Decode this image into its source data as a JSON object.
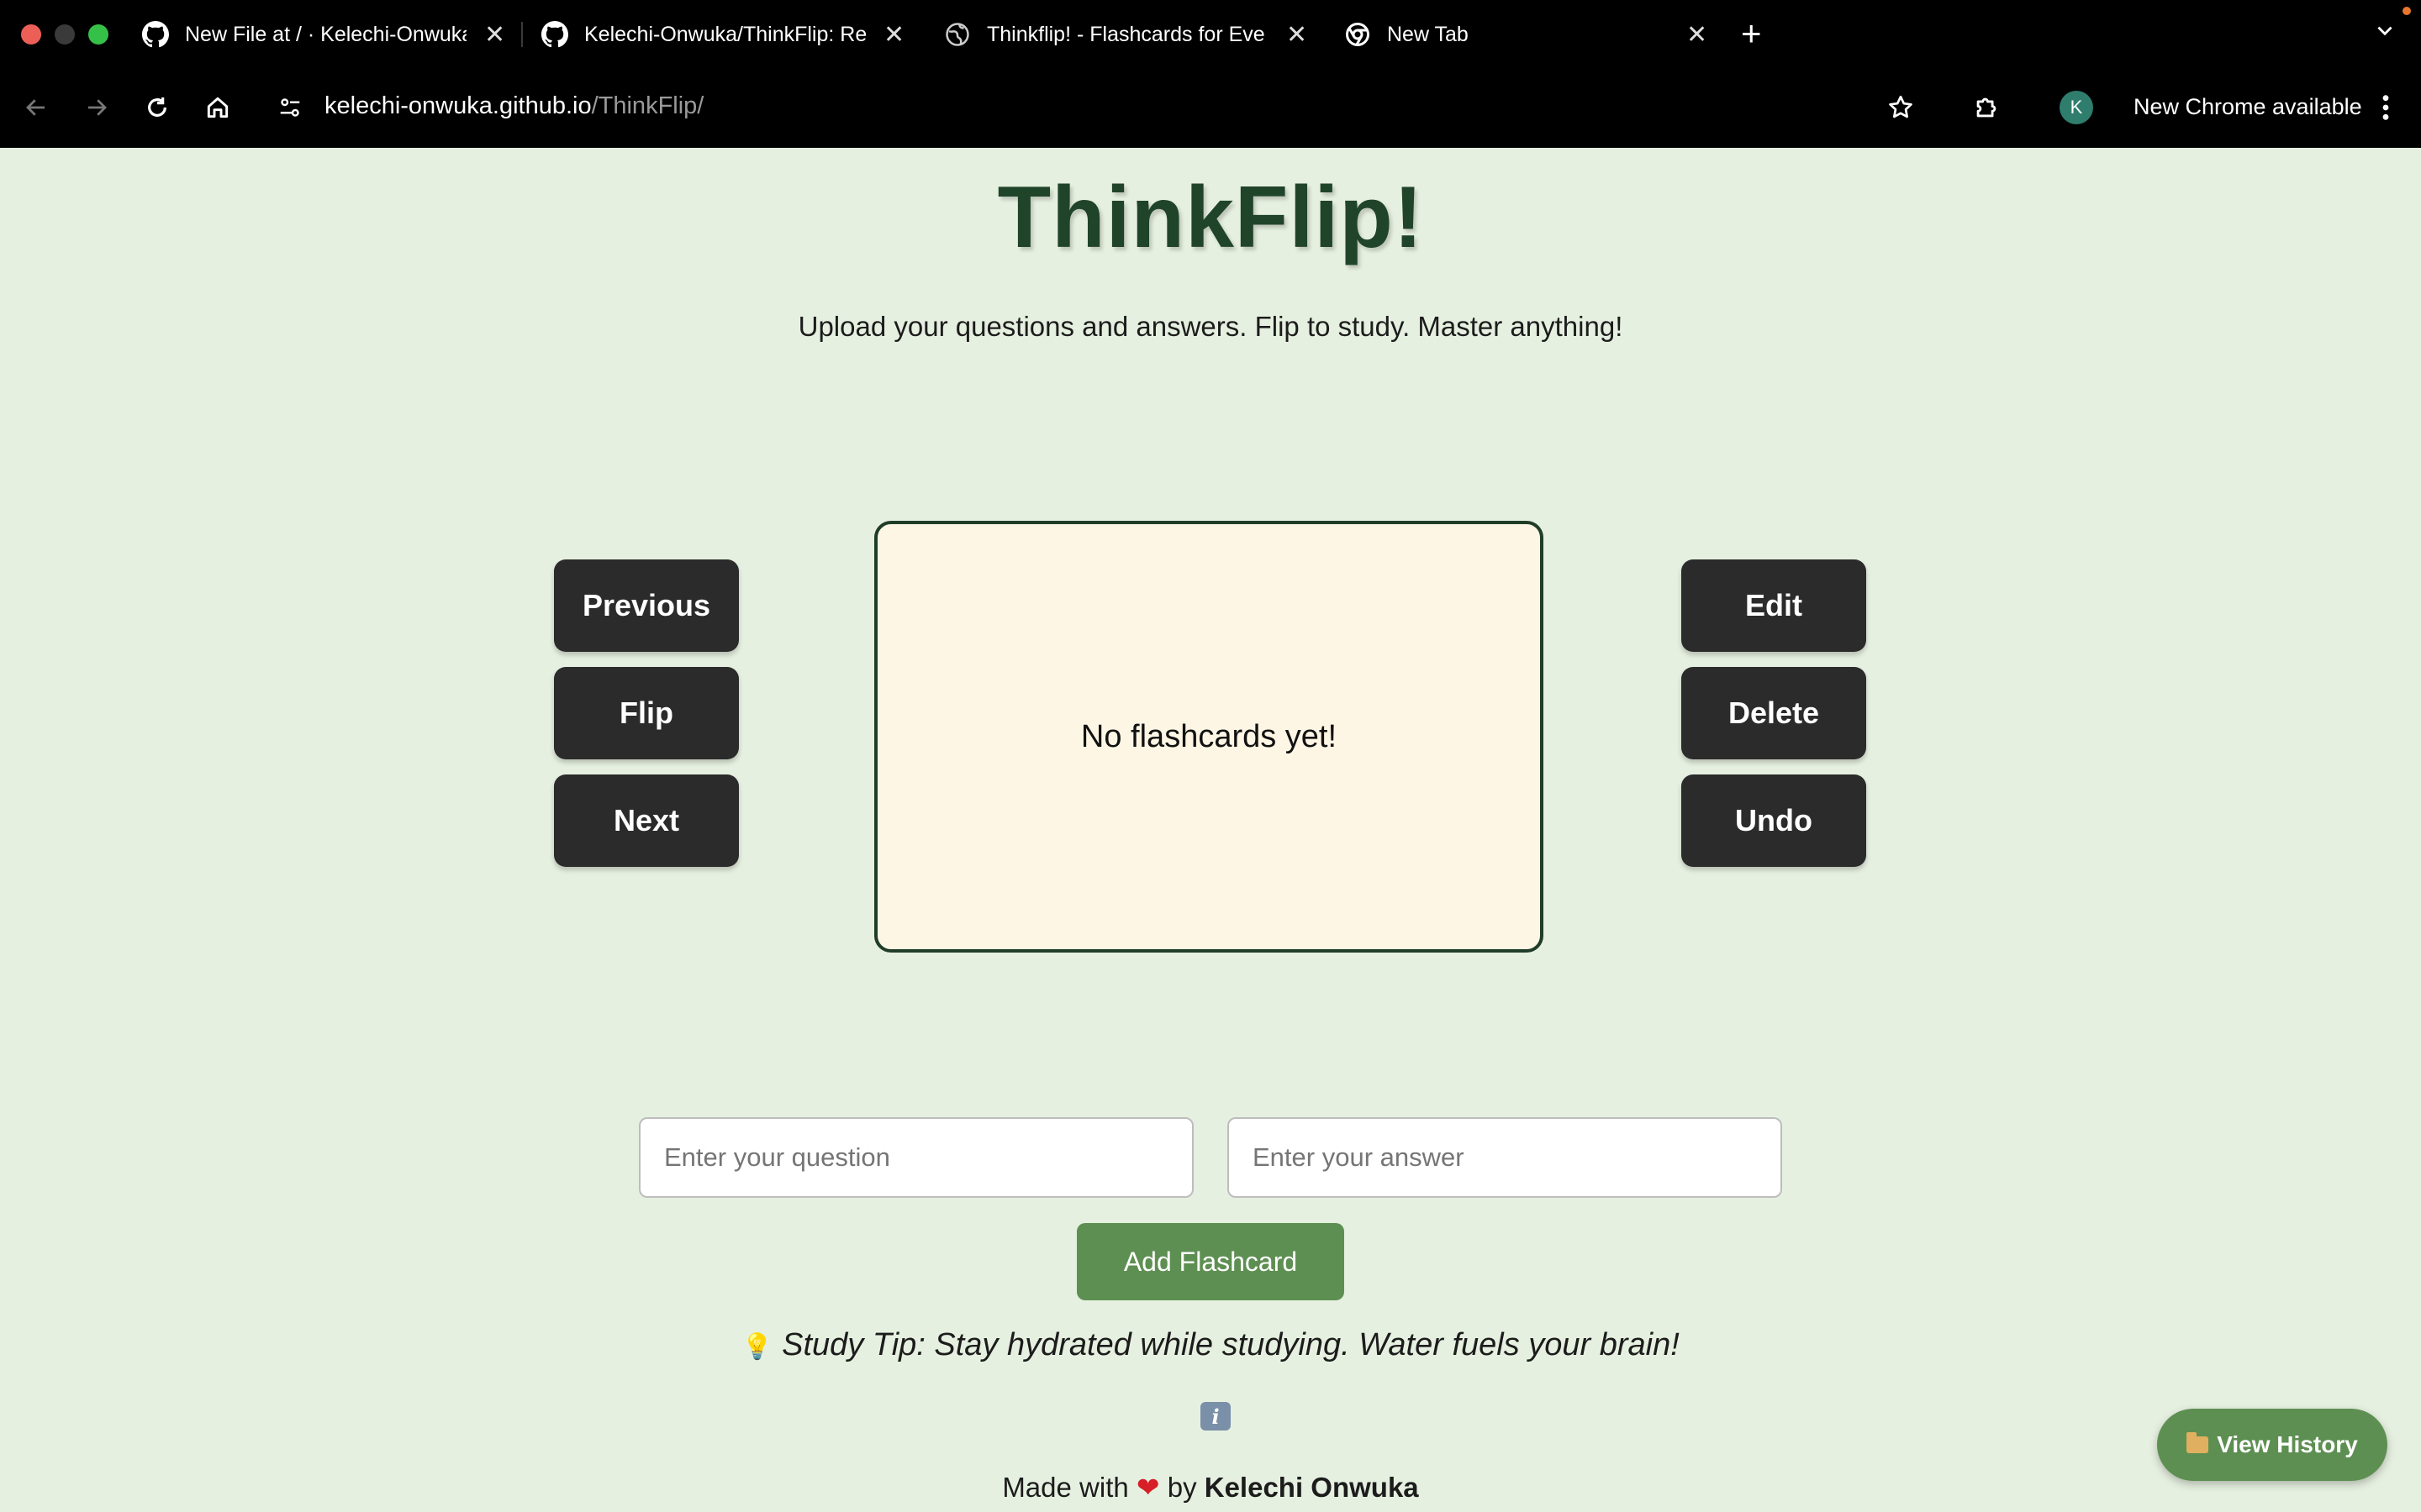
{
  "browser": {
    "tabs": [
      {
        "title": "New File at / · Kelechi-Onwuka",
        "icon": "github-icon"
      },
      {
        "title": "Kelechi-Onwuka/ThinkFlip: Re",
        "icon": "github-icon"
      },
      {
        "title": "Thinkflip! - Flashcards for Eve",
        "icon": "globe-icon"
      },
      {
        "title": "New Tab",
        "icon": "chrome-icon"
      }
    ],
    "close_glyph": "✕",
    "new_tab_glyph": "+",
    "url_domain": "kelechi-onwuka.github.io",
    "url_path": "/ThinkFlip/",
    "profile_initial": "K",
    "update_label": "New Chrome available"
  },
  "page": {
    "title": "ThinkFlip!",
    "subtitle": "Upload your questions and answers. Flip to study. Master anything!",
    "left_buttons": [
      "Previous",
      "Flip",
      "Next"
    ],
    "right_buttons": [
      "Edit",
      "Delete",
      "Undo"
    ],
    "card_text": "No flashcards yet!",
    "question_placeholder": "Enter your question",
    "answer_placeholder": "Enter your answer",
    "add_button": "Add Flashcard",
    "tip_icon": "💡",
    "tip": "Study Tip: Stay hydrated while studying. Water fuels your brain!",
    "info_glyph": "i",
    "footer_prefix": "Made with",
    "footer_heart": "❤",
    "footer_by": "by",
    "footer_author": "Kelechi Onwuka",
    "history_button": "View History"
  },
  "colors": {
    "page_bg": "#e6f0e0",
    "title": "#20442a",
    "dark_button": "#2b2b2b",
    "accent_green": "#5e8f52",
    "card_bg": "#fdf6e4",
    "card_border": "#1f3d28",
    "avatar": "#2f7d6d"
  }
}
